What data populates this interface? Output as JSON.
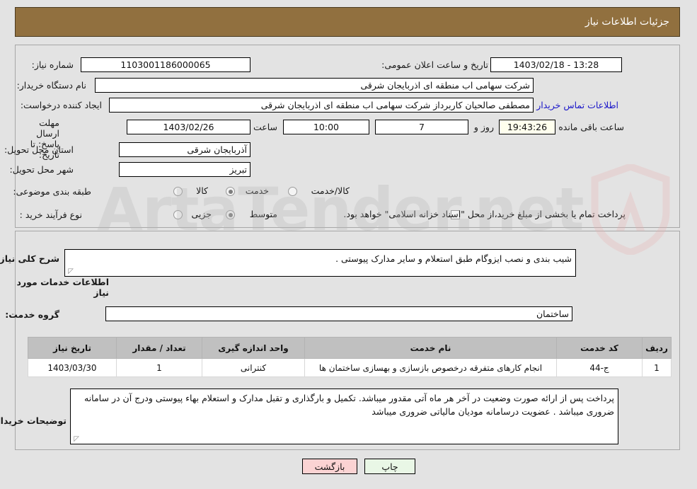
{
  "header": {
    "title": "جزئیات اطلاعات نیاز"
  },
  "fields": {
    "need_number": {
      "label": "شماره نیاز:",
      "value": "1103001186000065"
    },
    "announce_datetime": {
      "label": "تاریخ و ساعت اعلان عمومی:",
      "value": "13:28 - 1403/02/18"
    },
    "buyer_org": {
      "label": "نام دستگاه خریدار:",
      "value": "شرکت سهامی اب منطقه ای اذربایجان شرقی"
    },
    "request_creator": {
      "label": "ایجاد کننده درخواست:",
      "value": "مصطفی صالحیان کاربرداز شرکت سهامی اب منطقه ای اذربایجان شرقی"
    },
    "buyer_contact_link": "اطلاعات تماس خریدار",
    "deadline": {
      "label": "مهلت ارسال پاسخ: تا تاریخ:",
      "date": "1403/02/26",
      "time_label": "ساعت",
      "time": "10:00",
      "days": "7",
      "days_label": "روز و",
      "countdown": "19:43:26",
      "countdown_label": "ساعت باقی مانده"
    },
    "delivery_province": {
      "label": "استان محل تحویل:",
      "value": "آذربایجان شرقی"
    },
    "delivery_city": {
      "label": "شهر محل تحویل:",
      "value": "تبریز"
    },
    "category": {
      "label": "طبقه بندی موضوعی:",
      "options": [
        "کالا",
        "خدمت",
        "کالا/خدمت"
      ],
      "selected": "خدمت"
    },
    "purchase_process": {
      "label": "نوع فرآیند خرید :",
      "options": [
        "جزیی",
        "متوسط"
      ],
      "selected": "متوسط"
    },
    "treasury_note": {
      "text": "پرداخت تمام یا بخشی از مبلغ خرید،از محل \"اسناد خزانه اسلامی\" خواهد بود.",
      "checked": false
    }
  },
  "need_summary": {
    "label": "شرح کلی نیاز:",
    "value": "شیب بندی و نصب ایزوگام طبق استعلام و سایر مدارک پیوستی ."
  },
  "services_section": {
    "title": "اطلاعات خدمات مورد نیاز",
    "service_group_label": "گروه خدمت:",
    "service_group_value": "ساختمان"
  },
  "table": {
    "columns": [
      "ردیف",
      "کد خدمت",
      "نام خدمت",
      "واحد اندازه گیری",
      "تعداد / مقدار",
      "تاریخ نیاز"
    ],
    "rows": [
      {
        "row": "1",
        "service_code": "ج-44",
        "service_name": "انجام کارهای متفرقه درخصوص بازسازی و بهسازی ساختمان ها",
        "unit": "کنترانی",
        "quantity": "1",
        "need_date": "1403/03/30"
      }
    ]
  },
  "buyer_notes": {
    "label": "توضیحات خریدار:",
    "value": "پرداخت پس از ارائه صورت وضعیت در آخر هر ماه آتی مقدور میباشد. تکمیل و بارگذاری و تقبل مدارک و استعلام بهاء پیوستی ودرج آن در سامانه ضروری میباشد . عضویت درسامانه مودیان مالیاتی ضروری میباشد"
  },
  "buttons": {
    "print": "چاپ",
    "back": "بازگشت"
  },
  "watermark": {
    "text": "ArtaTender.net"
  },
  "colors": {
    "header_bg": "#91703f",
    "panel_bg": "#e3e3e3",
    "table_header_bg": "#c0c0c0",
    "link": "#1b17c9",
    "print_btn": "#e9f7e6",
    "back_btn": "#fbd3d3",
    "countdown_bg": "#ffffee"
  }
}
